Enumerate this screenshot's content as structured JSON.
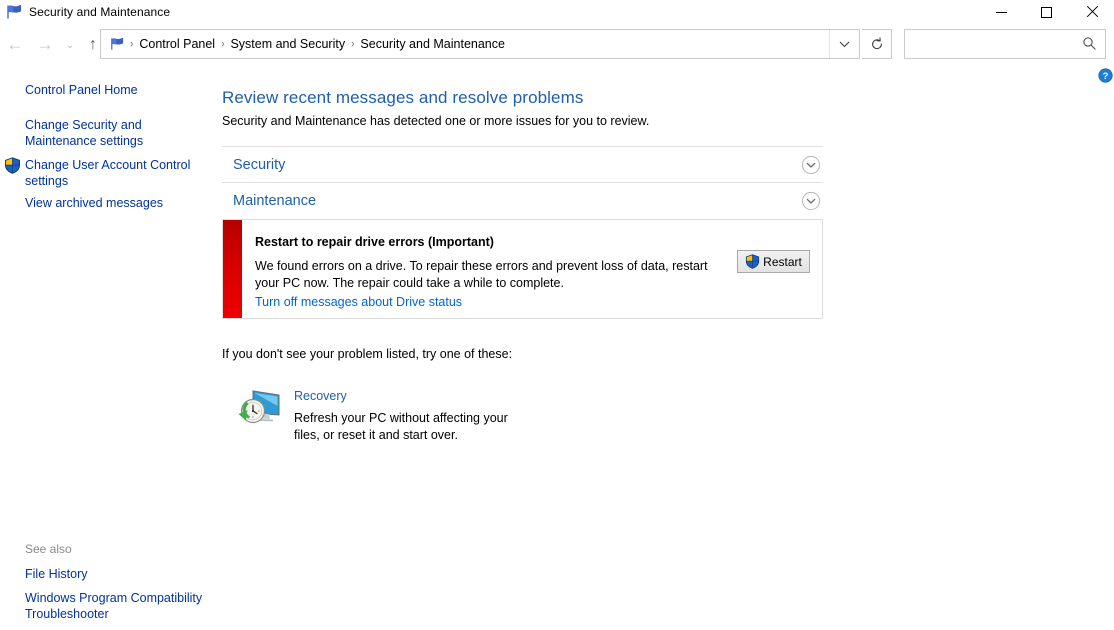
{
  "window": {
    "title": "Security and Maintenance",
    "icon": "flag-icon",
    "minimize_label": "Minimize",
    "maximize_label": "Maximize",
    "close_label": "Close"
  },
  "nav": {
    "back_label": "←",
    "forward_label": "→",
    "recent_label": "⌄",
    "up_label": "↑",
    "dropdown_label": "⌄",
    "refresh_label": "↻"
  },
  "breadcrumb": {
    "icon": "flag-icon",
    "separator": "›",
    "items": [
      {
        "label": "Control Panel"
      },
      {
        "label": "System and Security"
      },
      {
        "label": "Security and Maintenance"
      }
    ]
  },
  "search": {
    "value": "",
    "placeholder": "",
    "icon": "search-icon"
  },
  "help": {
    "label": "?",
    "icon": "help-icon"
  },
  "sidebar": {
    "items": [
      {
        "label": "Control Panel Home"
      },
      {
        "label": "Change Security and Maintenance settings"
      },
      {
        "label": "Change User Account Control settings",
        "icon": "uac-shield-icon"
      },
      {
        "label": "View archived messages"
      }
    ],
    "see_also": {
      "heading": "See also",
      "links": [
        {
          "label": "File History"
        },
        {
          "label": "Windows Program Compatibility Troubleshooter"
        }
      ]
    }
  },
  "main": {
    "heading": "Review recent messages and resolve problems",
    "subtitle": "Security and Maintenance has detected one or more issues for you to review.",
    "sections": [
      {
        "title": "Security",
        "expander_icon": "chevron-down-circle-icon",
        "expanded": false
      },
      {
        "title": "Maintenance",
        "expander_icon": "chevron-down-circle-icon",
        "expanded": false
      }
    ],
    "alert": {
      "severity": "Important",
      "severity_color": "#cc0000",
      "title": "Restart to repair drive errors  (Important)",
      "body": "We found errors on a drive. To repair these errors and prevent loss of data, restart your PC now. The repair could take a while to complete.",
      "link": "Turn off messages about Drive status",
      "button_label": "Restart",
      "button_icon": "uac-shield-icon"
    },
    "suggestions": {
      "label": "If you don't see your problem listed, try one of these:",
      "items": [
        {
          "title": "Recovery",
          "icon": "recovery-icon",
          "description": "Refresh your PC without affecting your files, or reset it and start over."
        }
      ]
    }
  },
  "colors": {
    "link_blue": "#003399",
    "heading_blue": "#1f5fa9",
    "action_link_blue": "#0066cc",
    "alert_red": "#d40000",
    "shield_gold": "#ffc400",
    "shield_blue": "#1f5fc0"
  }
}
